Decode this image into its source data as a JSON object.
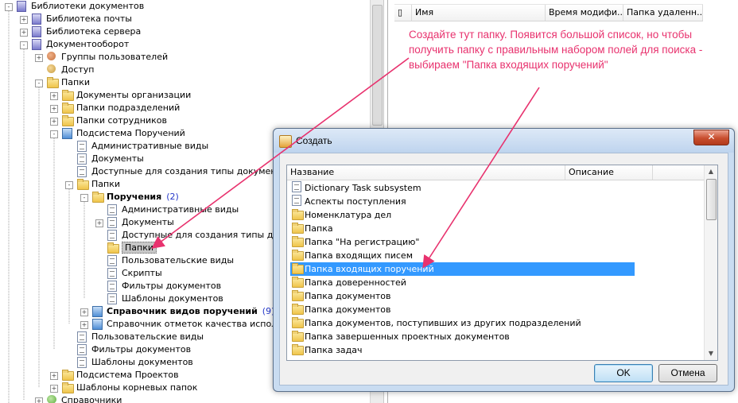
{
  "tree": {
    "items": [
      {
        "label": "Библиотеки документов",
        "icon": "library-icon"
      },
      {
        "label": "Библиотека почты",
        "icon": "library-icon"
      },
      {
        "label": "Библиотека сервера",
        "icon": "library-icon"
      },
      {
        "label": "Документооборот",
        "icon": "library-icon"
      },
      {
        "label": "Группы пользователей",
        "icon": "group-icon"
      },
      {
        "label": "Доступ",
        "icon": "key-icon"
      },
      {
        "label": "Папки",
        "icon": "folder-icon"
      },
      {
        "label": "Документы организации",
        "icon": "folder-icon"
      },
      {
        "label": "Папки подразделений",
        "icon": "folder-icon"
      },
      {
        "label": "Папки сотрудников",
        "icon": "folder-icon"
      },
      {
        "label": "Подсистема Поручений",
        "icon": "subsystem-icon"
      },
      {
        "label": "Административные виды",
        "icon": "document-icon"
      },
      {
        "label": "Документы",
        "icon": "document-icon"
      },
      {
        "label": "Доступные для создания типы документов",
        "icon": "document-icon"
      },
      {
        "label": "Папки",
        "icon": "folder-icon"
      },
      {
        "label": "Поручения",
        "icon": "folder-icon",
        "count": "(2)"
      },
      {
        "label": "Административные виды",
        "icon": "document-icon"
      },
      {
        "label": "Документы",
        "icon": "document-icon"
      },
      {
        "label": "Доступные для создания типы докум",
        "icon": "document-icon"
      },
      {
        "label": "Папки",
        "icon": "folder-icon"
      },
      {
        "label": "Пользовательские виды",
        "icon": "document-icon"
      },
      {
        "label": "Скрипты",
        "icon": "document-icon"
      },
      {
        "label": "Фильтры документов",
        "icon": "document-icon"
      },
      {
        "label": "Шаблоны документов",
        "icon": "document-icon"
      },
      {
        "label": "Справочник видов поручений",
        "icon": "card-icon",
        "count": "(9)"
      },
      {
        "label": "Справочник отметок качества исполнен",
        "icon": "card-icon"
      },
      {
        "label": "Пользовательские виды",
        "icon": "document-icon"
      },
      {
        "label": "Фильтры документов",
        "icon": "document-icon"
      },
      {
        "label": "Шаблоны документов",
        "icon": "document-icon"
      },
      {
        "label": "Подсистема Проектов",
        "icon": "folder-icon"
      },
      {
        "label": "Шаблоны корневых папок",
        "icon": "folder-icon"
      },
      {
        "label": "Справочники",
        "icon": "green-folder-icon"
      }
    ]
  },
  "right_panel": {
    "columns": [
      "Имя",
      "Время модифи...",
      "Папка удаленн..."
    ]
  },
  "annotation": {
    "text": "Создайте тут папку. Появится большой список, но чтобы получить папку с правильным набором полей для поиска - выбираем \"Папка входящих поручений\"",
    "color": "#e8326e"
  },
  "dialog": {
    "title": "Создать",
    "columns": [
      "Название",
      "Описание"
    ],
    "items": [
      "Dictionary Task subsystem",
      "Аспекты поступления",
      "Номенклатура дел",
      "Папка",
      "Папка \"На регистрацию\"",
      "Папка входящих писем",
      "Папка входящих поручений",
      "Папка доверенностей",
      "Папка документов",
      "Папка документов",
      "Папка документов, поступивших из других подразделений",
      "Папка завершенных проектных документов",
      "Папка задач"
    ],
    "selected_index": 6,
    "ok_label": "OK",
    "cancel_label": "Отмена",
    "selection_color": "#3399ff"
  }
}
